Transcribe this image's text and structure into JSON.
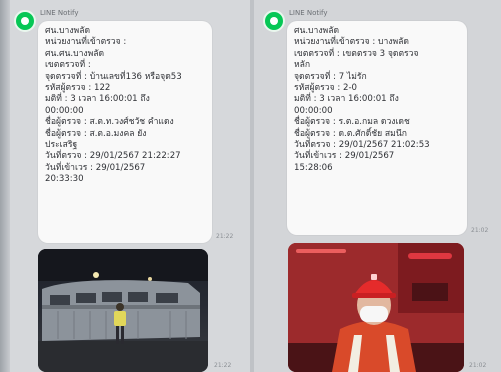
{
  "colors": {
    "line_green": "#06c755",
    "bubble": "#f9f9f9",
    "background": "#d6d8db"
  },
  "chats": [
    {
      "sender": "LINE Notify",
      "message_lines": [
        "ศน.บางพลัด",
        "หน่วยงานที่เข้าตรวจ :",
        "ศน.ศน.บางพลัด",
        "เขตตรวจที่ :",
        "จุดตรวจที่ : บ้านเลขที่136 หรือจุด53",
        "รหัสผู้ตรวจ : 122",
        "มติที่ : 3 เวลา 16:00:01 ถึง",
        "00:00:00",
        "ชื่อผู้ตรวจ : ส.ต.ท.วงศ์ชวัช คำแดง",
        "ชื่อผู้ตรวจ : ส.ต.อ.มงคล ยัง",
        "ประเสริฐ",
        "วันที่ตรวจ : 29/01/2567 21:22:27",
        "วันที่เข้าเวร : 29/01/2567",
        "20:33:30"
      ],
      "message_time": "21:22",
      "photo_time": "21:22",
      "photo_icon": "night-patrol-photo-icon"
    },
    {
      "sender": "LINE Notify",
      "message_lines": [
        "ศน.บางพลัด",
        "หน่วยงานที่เข้าตรวจ : บางพลัด",
        "เขตตรวจที่ : เขตตรวจ 3 จุดตรวจ",
        "หลัก",
        "จุดตรวจที่ : 7 ไม่รัก",
        "รหัสผู้ตรวจ : 2-0",
        "มติที่ : 3 เวลา 16:00:01 ถึง",
        "00:00:00",
        "ชื่อผู้ตรวจ : ร.ต.อ.กมล ดวงเดช",
        "ชื่อผู้ตรวจ : ด.ต.ศักดิ์ชัย สมนึก",
        "วันที่ตรวจ : 29/01/2567 21:02:53",
        "วันที่เข้าเวร : 29/01/2567",
        "15:28:06"
      ],
      "message_time": "21:02",
      "photo_time": "21:02",
      "photo_icon": "officer-selfie-photo-icon"
    }
  ]
}
